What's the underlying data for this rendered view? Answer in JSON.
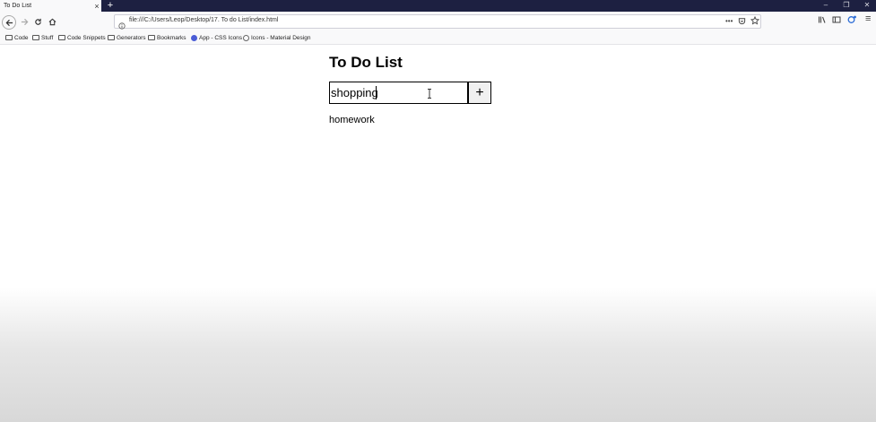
{
  "window": {
    "tab_title": "To Do List",
    "tab_close": "×",
    "new_tab": "+",
    "minimize": "–",
    "restore": "❐",
    "close": "✕"
  },
  "navbar": {
    "url": "file:///C:/Users/Leop/Desktop/17. To do List/index.html",
    "page_actions": "•••",
    "menu": "≡"
  },
  "bookmarks": [
    {
      "label": "Code",
      "icon": "folder"
    },
    {
      "label": "Stuff",
      "icon": "folder"
    },
    {
      "label": "Code Snippets",
      "icon": "folder"
    },
    {
      "label": "Generators",
      "icon": "folder"
    },
    {
      "label": "Bookmarks",
      "icon": "folder"
    },
    {
      "label": "App - CSS Icons",
      "icon": "site",
      "color": "#4a5cd6"
    },
    {
      "label": "Icons - Material Design",
      "icon": "site",
      "color": "#666666"
    }
  ],
  "page": {
    "heading": "To Do List",
    "input_value": "shopping",
    "add_label": "+",
    "items": [
      "homework"
    ]
  }
}
